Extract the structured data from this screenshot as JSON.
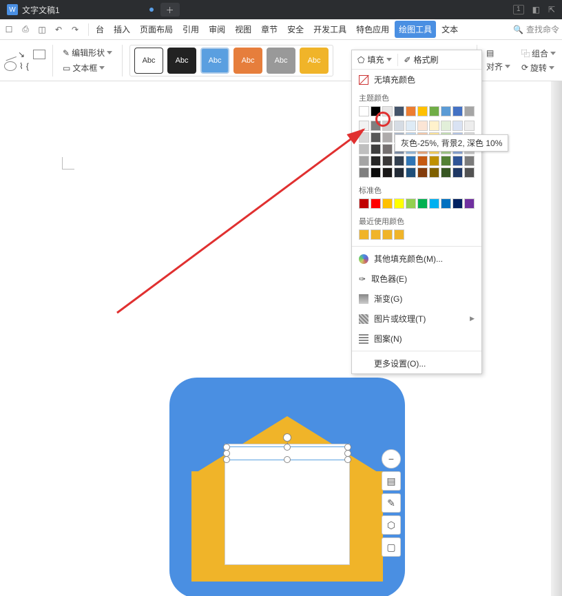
{
  "titlebar": {
    "doc_icon_letter": "W",
    "doc_title": "文字文稿1",
    "badge": "1"
  },
  "menubar": {
    "tabs": [
      "台",
      "插入",
      "页面布局",
      "引用",
      "审阅",
      "视图",
      "章节",
      "安全",
      "开发工具",
      "特色应用",
      "绘图工具",
      "文本"
    ],
    "active_index": 11,
    "search_placeholder": "查找命令"
  },
  "ribbon": {
    "edit_shape": "编辑形状",
    "text_box": "文本框",
    "abc_label": "Abc",
    "fill_label": "填充",
    "format_painter": "格式刷",
    "align": "对齐",
    "group": "组合",
    "rotate": "旋转"
  },
  "dropdown": {
    "top_fill": "填充",
    "top_brush": "格式刷",
    "no_fill": "无填充颜色",
    "theme_colors": "主题颜色",
    "standard_colors": "标准色",
    "recent_colors": "最近使用颜色",
    "more_fill": "其他填充颜色(M)...",
    "eyedropper": "取色器(E)",
    "gradient": "渐变(G)",
    "texture": "图片或纹理(T)",
    "pattern": "图案(N)",
    "more_settings": "更多设置(O)...",
    "theme_row1": [
      "#ffffff",
      "#000000",
      "#e7e6e6",
      "#44546a",
      "#ed7d31",
      "#ffc000",
      "#70ad47",
      "#5b9bd5",
      "#4472c4",
      "#a5a5a5"
    ],
    "theme_grid": [
      [
        "#f2f2f2",
        "#7f7f7f",
        "#d0cece",
        "#d6dce4",
        "#deebf6",
        "#fbe5d5",
        "#fff2cc",
        "#e2efd9",
        "#d9e2f3",
        "#ededed"
      ],
      [
        "#d8d8d8",
        "#595959",
        "#aeabab",
        "#adb9ca",
        "#bdd7ee",
        "#f7cbac",
        "#fee599",
        "#c5e0b3",
        "#b4c6e7",
        "#dbdbdb"
      ],
      [
        "#bfbfbf",
        "#3f3f3f",
        "#757070",
        "#8496b0",
        "#9cc3e5",
        "#f4b183",
        "#ffd965",
        "#a8d08d",
        "#8eaadb",
        "#c9c9c9"
      ],
      [
        "#a5a5a5",
        "#262626",
        "#3a3838",
        "#323f4f",
        "#2e75b5",
        "#c55a11",
        "#bf9000",
        "#538135",
        "#2f5496",
        "#7b7b7b"
      ],
      [
        "#7f7f7f",
        "#0c0c0c",
        "#171616",
        "#222a35",
        "#1e4e79",
        "#833c0b",
        "#7f6000",
        "#375623",
        "#1f3864",
        "#525252"
      ]
    ],
    "standard_row": [
      "#c00000",
      "#ff0000",
      "#ffc000",
      "#ffff00",
      "#92d050",
      "#00b050",
      "#00b0f0",
      "#0070c0",
      "#002060",
      "#7030a0"
    ],
    "recent_row": [
      "#f0b429",
      "#f0b429",
      "#f0b429",
      "#f0b429"
    ]
  },
  "tooltip": "灰色-25%, 背景2, 深色 10%",
  "highlight_color": "#d0cece"
}
